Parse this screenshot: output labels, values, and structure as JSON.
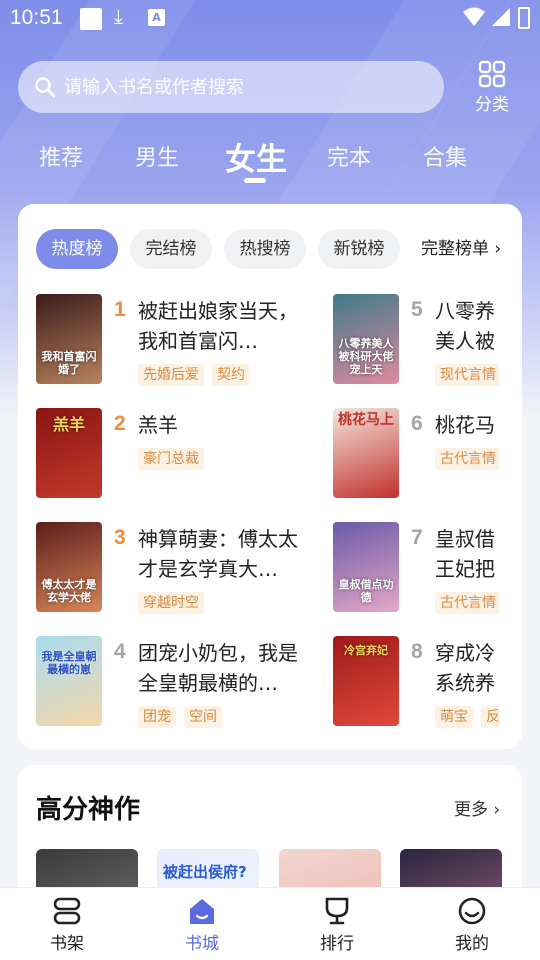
{
  "status_bar": {
    "time": "10:51"
  },
  "search": {
    "placeholder": "请输入书名或作者搜索"
  },
  "category": {
    "label": "分类"
  },
  "tabs": [
    {
      "label": "推荐"
    },
    {
      "label": "男生"
    },
    {
      "label": "女生",
      "active": true
    },
    {
      "label": "完本"
    },
    {
      "label": "合集"
    }
  ],
  "ranking": {
    "chips": [
      {
        "label": "热度榜",
        "active": true
      },
      {
        "label": "完结榜"
      },
      {
        "label": "热搜榜"
      },
      {
        "label": "新锐榜"
      }
    ],
    "more_label": "完整榜单",
    "books": [
      {
        "rank": "1",
        "title": "被赶出娘家当天，我和首富闪…",
        "tags": [
          "先婚后爱",
          "契约"
        ],
        "cover_text": "我和首富闪婚了",
        "cover_colors": [
          "#3a1c1c",
          "#b9825d"
        ]
      },
      {
        "rank": "2",
        "title": "羔羊",
        "tags": [
          "豪门总裁"
        ],
        "cover_text": "羔羊",
        "cover_colors": [
          "#8b1414",
          "#c23a2a"
        ]
      },
      {
        "rank": "3",
        "title": "神算萌妻：傅太太才是玄学真大…",
        "tags": [
          "穿越时空"
        ],
        "cover_text": "傅太太才是玄学大佬",
        "cover_colors": [
          "#5c1d1a",
          "#d6875a"
        ]
      },
      {
        "rank": "4",
        "title": "团宠小奶包，我是全皇朝最横的…",
        "tags": [
          "团宠",
          "空间"
        ],
        "cover_text": "我是全皇朝最横的崽",
        "cover_colors": [
          "#a9dcf0",
          "#f4d7a8"
        ]
      },
      {
        "rank": "5",
        "title": "八零养美人被",
        "tags": [
          "现代言情"
        ],
        "cover_text": "八零养美人被科研大佬宠上天",
        "cover_colors": [
          "#3f7a8a",
          "#e08aa0"
        ]
      },
      {
        "rank": "6",
        "title": "桃花马",
        "tags": [
          "古代言情"
        ],
        "cover_text": "桃花马上",
        "cover_colors": [
          "#f4e6e0",
          "#c2302a"
        ]
      },
      {
        "rank": "7",
        "title": "皇叔借王妃把",
        "tags": [
          "古代言情"
        ],
        "cover_text": "皇叔借点功德",
        "cover_colors": [
          "#6a5aa8",
          "#e6a7c8"
        ]
      },
      {
        "rank": "8",
        "title": "穿成冷系统养",
        "tags": [
          "萌宝",
          "反"
        ],
        "cover_text": "冷宫弃妃",
        "cover_colors": [
          "#9e1a1a",
          "#e04a3a"
        ]
      }
    ]
  },
  "high_score": {
    "title": "高分神作",
    "more_label": "更多",
    "covers": [
      {
        "colors": [
          "#3a3a3a",
          "#8a8a8a"
        ],
        "text": ""
      },
      {
        "colors": [
          "#e6eefb",
          "#f6f9ff"
        ],
        "text": "被赶出侯府?"
      },
      {
        "colors": [
          "#f2d7cf",
          "#e9a6a0"
        ],
        "text": ""
      },
      {
        "colors": [
          "#2a2340",
          "#c07a8e"
        ],
        "text": ""
      }
    ]
  },
  "bottom_nav": [
    {
      "label": "书架",
      "icon": "bookshelf-icon"
    },
    {
      "label": "书城",
      "icon": "bookstore-icon",
      "active": true
    },
    {
      "label": "排行",
      "icon": "trophy-icon"
    },
    {
      "label": "我的",
      "icon": "profile-icon"
    }
  ],
  "colors": {
    "accent": "#7d8ce8",
    "rank_highlight": "#ee8a3b",
    "tag_text": "#d98a3f",
    "tag_bg": "#fdf1e4"
  }
}
